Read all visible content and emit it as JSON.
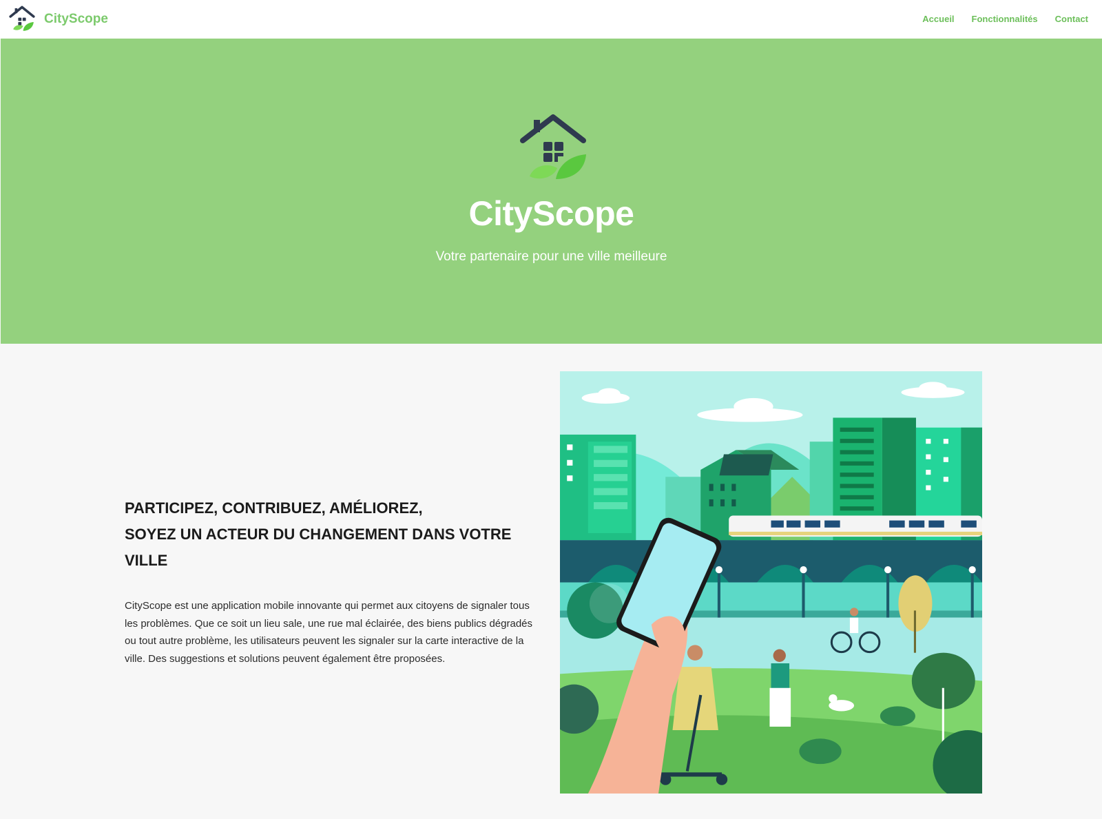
{
  "app": {
    "brand_name": "CityScope",
    "brand_color": "#7cca6c"
  },
  "nav": {
    "items": [
      {
        "label": "Accueil"
      },
      {
        "label": "Fonctionnalités"
      },
      {
        "label": "Contact"
      }
    ]
  },
  "hero": {
    "background": "#94d17e",
    "title": "CityScope",
    "subtitle": "Votre partenaire pour une ville meilleure"
  },
  "main": {
    "headline_lines": [
      "PARTICIPEZ, CONTRIBUEZ, AMÉLIOREZ,",
      "SOYEZ UN ACTEUR DU CHANGEMENT DANS VOTRE VILLE"
    ],
    "description": "CityScope est une application mobile innovante qui permet aux citoyens de signaler tous les problèmes. Que ce soit un lieu sale, une rue mal éclairée, des biens publics dégradés ou tout autre problème, les utilisateurs peuvent les signaler sur la carte interactive de la ville. Des suggestions et solutions peuvent également être proposées."
  },
  "icons": {
    "brand_logo": "house-leaf-icon",
    "hero_logo": "house-leaf-icon"
  }
}
